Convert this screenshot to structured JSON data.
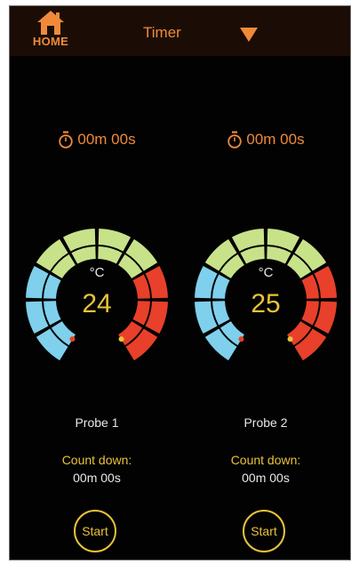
{
  "header": {
    "home_label": "HOME",
    "mode_title": "Timer",
    "accent_color": "#f08a3a"
  },
  "probes": [
    {
      "timer": "00m 00s",
      "unit": "°C",
      "temperature": "24",
      "name": "Probe 1",
      "countdown_label": "Count down:",
      "countdown_value": "00m 00s",
      "start_label": "Start"
    },
    {
      "timer": "00m 00s",
      "unit": "°C",
      "temperature": "25",
      "name": "Probe 2",
      "countdown_label": "Count down:",
      "countdown_value": "00m 00s",
      "start_label": "Start"
    }
  ],
  "gauge_colors": {
    "cool": "#7fd0ec",
    "mid": "#c8e28a",
    "hot": "#e8402a",
    "value_text": "#e8c23a",
    "unit_text": "#e8e8e8"
  }
}
